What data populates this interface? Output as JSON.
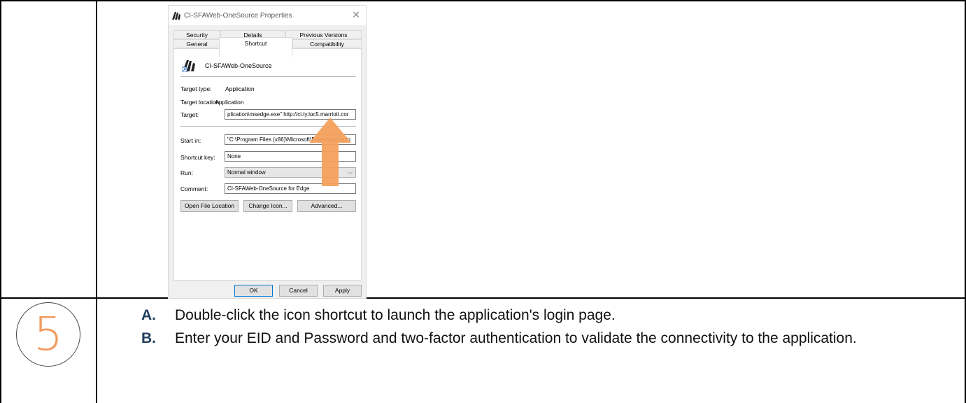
{
  "dialog": {
    "title": "CI-SFAWeb-OneSource Properties",
    "tabs_row1": [
      "Security",
      "Details",
      "Previous Versions"
    ],
    "tabs_row2": [
      "General",
      "Shortcut",
      "Compatibility"
    ],
    "active_tab": "Shortcut",
    "shortcut_name": "CI-SFAWeb-OneSource",
    "target_type_label": "Target type:",
    "target_type_value": "Application",
    "target_location_label": "Target location:",
    "target_location_value": "Application",
    "target_label": "Target:",
    "target_value": "plication\\msedge.exe\" http://ci.ty.loc5.marriott.cor",
    "start_in_label": "Start in:",
    "start_in_value": "\"C:\\Program Files (x86)\\Microsoft\\Edge\\Applicatio",
    "shortcut_key_label": "Shortcut key:",
    "shortcut_key_value": "None",
    "run_label": "Run:",
    "run_value": "Normal window",
    "comment_label": "Comment:",
    "comment_value": "CI-SFAWeb-OneSource for Edge",
    "buttons_row": [
      "Open File Location",
      "Change Icon...",
      "Advanced..."
    ],
    "footer_buttons": [
      "OK",
      "Cancel",
      "Apply"
    ]
  },
  "step": {
    "number": "5",
    "items": [
      {
        "letter": "A.",
        "text": "Double-click the icon shortcut to launch the application's login page."
      },
      {
        "letter": "B.",
        "text": "Enter your EID and Password and two-factor authentication to validate the connectivity to the application."
      }
    ]
  },
  "colors": {
    "arrow": "#f4a15d",
    "step_number": "#f29a5b",
    "letter": "#1f3b5c",
    "dialog_bg": "#f0f0f0",
    "default_button_border": "#0078d7"
  }
}
